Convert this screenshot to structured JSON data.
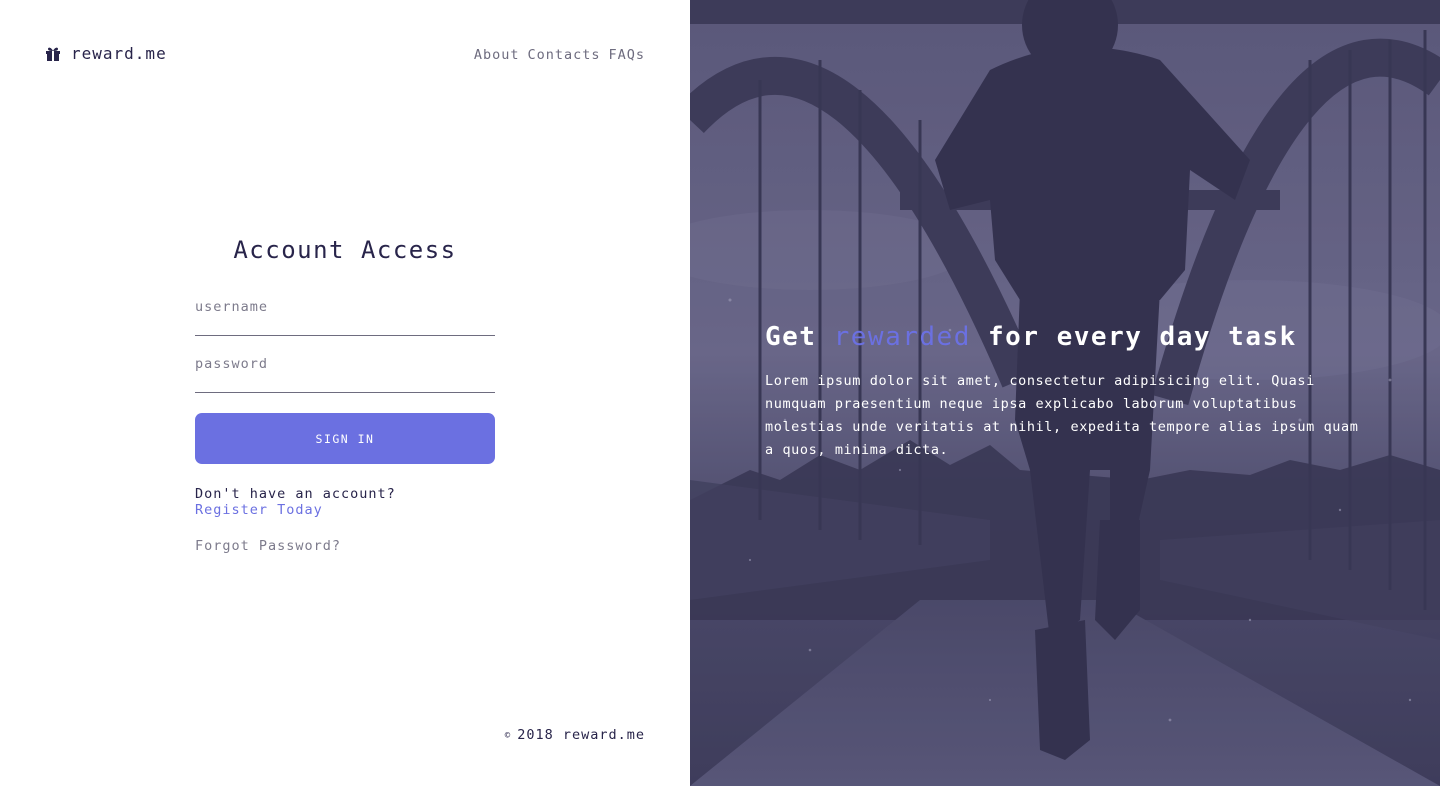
{
  "brand": {
    "icon": "gift-icon",
    "name": "reward.me"
  },
  "nav": {
    "items": [
      "About",
      "Contacts",
      "FAQs"
    ]
  },
  "login": {
    "title": "Account Access",
    "username_placeholder": "username",
    "password_placeholder": "password",
    "signin_label": "SIGN IN",
    "no_account_text": "Don't have an account?",
    "register_label": "Register Today",
    "forgot_label": "Forgot Password?"
  },
  "footer": {
    "copyright_symbol": "©",
    "text": "2018 reward.me"
  },
  "hero": {
    "title_prefix": "Get ",
    "title_accent": "rewarded",
    "title_suffix": " for every day task",
    "body": "Lorem ipsum dolor sit amet, consectetur adipisicing elit. Quasi numquam praesentium neque ipsa explicabo laborum voluptatibus molestias unde veritatis at nihil, expedita tempore alias ipsum quam a quos, minima dicta."
  },
  "colors": {
    "accent": "#6b70e1",
    "dark_text": "#28244a",
    "muted_text": "#6e6c7f",
    "hero_overlay": "#4a4868"
  }
}
